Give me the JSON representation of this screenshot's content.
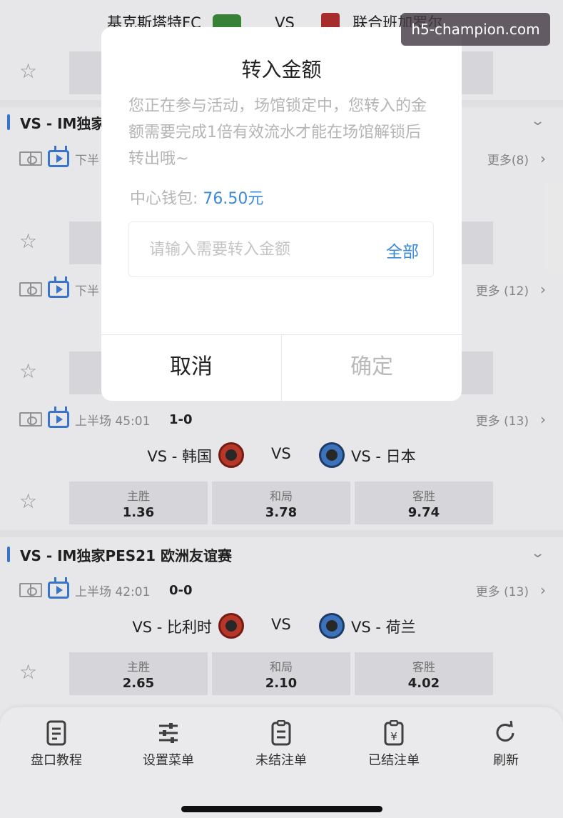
{
  "top_match": {
    "teams": "基克斯塔特FC",
    "vs": "VS",
    "away": "联合班加罗尔"
  },
  "leagues": [
    {
      "title": "VS - IM独家"
    },
    {
      "title": "VS - IM独家PES21 欧洲友谊赛"
    }
  ],
  "matches": [
    {
      "period": "下半",
      "more": "更多(8)"
    },
    {
      "period": "下半",
      "more": "更多 (12)"
    },
    {
      "period": "上半场 45:01",
      "score": "1-0",
      "more": "更多 (13)",
      "home": "VS - 韩国",
      "vs": "VS",
      "away": "VS - 日本",
      "odds": [
        {
          "label": "主胜",
          "value": "1.36"
        },
        {
          "label": "和局",
          "value": "3.78"
        },
        {
          "label": "客胜",
          "value": "9.74"
        }
      ]
    },
    {
      "period": "上半场 42:01",
      "score": "0-0",
      "more": "更多 (13)",
      "home": "VS - 比利时",
      "vs": "VS",
      "away": "VS - 荷兰",
      "odds": [
        {
          "label": "主胜",
          "value": "2.65"
        },
        {
          "label": "和局",
          "value": "2.10"
        },
        {
          "label": "客胜",
          "value": "4.02"
        }
      ]
    }
  ],
  "bottom_nav": [
    {
      "label": "盘口教程",
      "icon": "document-icon"
    },
    {
      "label": "设置菜单",
      "icon": "sliders-icon"
    },
    {
      "label": "未结注单",
      "icon": "clipboard-icon"
    },
    {
      "label": "已结注单",
      "icon": "settled-clipboard-icon"
    },
    {
      "label": "刷新",
      "icon": "refresh-icon"
    }
  ],
  "dialog": {
    "title": "转入金额",
    "message": "您正在参与活动，场馆锁定中，您转入的金额需要完成1倍有效流水才能在场馆解锁后转出哦~",
    "wallet_label": "中心钱包:",
    "wallet_value": "76.50元",
    "input_placeholder": "请输入需要转入金额",
    "all_label": "全部",
    "cancel_label": "取消",
    "confirm_label": "确定"
  },
  "watermark": "h5-champion.com"
}
